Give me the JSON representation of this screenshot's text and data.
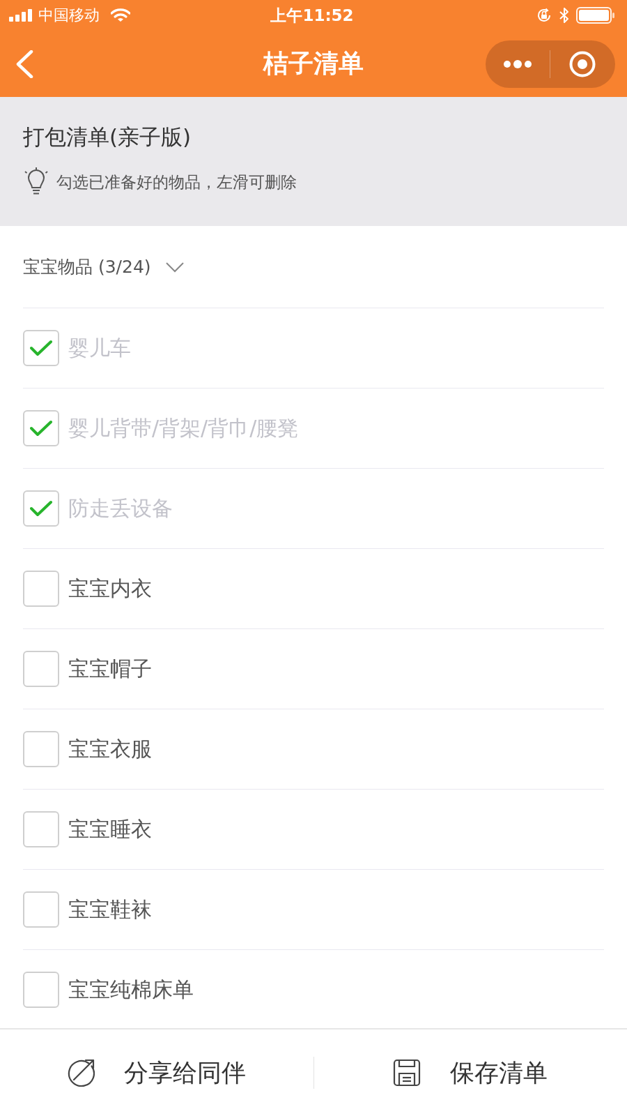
{
  "status_bar": {
    "carrier": "中国移动",
    "time": "上午11:52"
  },
  "nav_bar": {
    "title": "桔子清单"
  },
  "list_header": {
    "title": "打包清单(亲子版)",
    "hint": "勾选已准备好的物品，左滑可删除"
  },
  "category": {
    "label": "宝宝物品 (3/24)",
    "expanded": true
  },
  "items": [
    {
      "label": "婴儿车",
      "checked": true
    },
    {
      "label": "婴儿背带/背架/背巾/腰凳",
      "checked": true
    },
    {
      "label": "防走丢设备",
      "checked": true
    },
    {
      "label": "宝宝内衣",
      "checked": false
    },
    {
      "label": "宝宝帽子",
      "checked": false
    },
    {
      "label": "宝宝衣服",
      "checked": false
    },
    {
      "label": "宝宝睡衣",
      "checked": false
    },
    {
      "label": "宝宝鞋袜",
      "checked": false
    },
    {
      "label": "宝宝纯棉床单",
      "checked": false
    }
  ],
  "bottom_bar": {
    "actions": [
      {
        "kind": "share",
        "label": "分享给同伴"
      },
      {
        "kind": "save",
        "label": "保存清单"
      }
    ]
  }
}
